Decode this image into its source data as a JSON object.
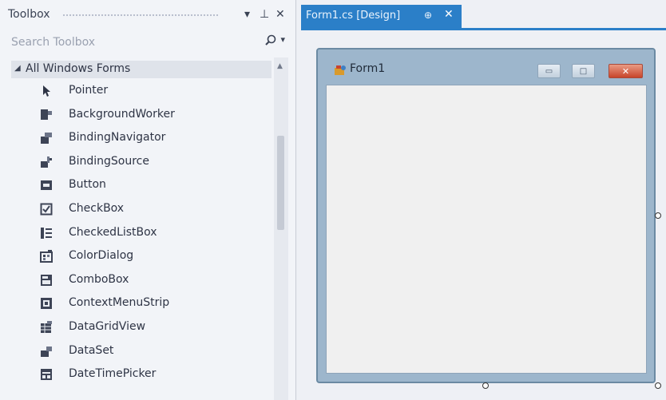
{
  "toolbox": {
    "title": "Toolbox",
    "dropdown_icon": "▾",
    "pin_icon": "⊥",
    "close_icon": "✕",
    "search_placeholder": "Search Toolbox",
    "search_icon": "⌕",
    "search_dropdown": "▾",
    "section": {
      "label": "All Windows Forms",
      "expanded_icon": "◢"
    },
    "items": [
      {
        "label": "Pointer",
        "icon": "pointer-icon"
      },
      {
        "label": "BackgroundWorker",
        "icon": "background-worker-icon"
      },
      {
        "label": "BindingNavigator",
        "icon": "binding-navigator-icon"
      },
      {
        "label": "BindingSource",
        "icon": "binding-source-icon"
      },
      {
        "label": "Button",
        "icon": "button-icon"
      },
      {
        "label": "CheckBox",
        "icon": "checkbox-icon"
      },
      {
        "label": "CheckedListBox",
        "icon": "checked-list-box-icon"
      },
      {
        "label": "ColorDialog",
        "icon": "color-dialog-icon"
      },
      {
        "label": "ComboBox",
        "icon": "combobox-icon"
      },
      {
        "label": "ContextMenuStrip",
        "icon": "context-menu-strip-icon"
      },
      {
        "label": "DataGridView",
        "icon": "data-grid-view-icon"
      },
      {
        "label": "DataSet",
        "icon": "dataset-icon"
      },
      {
        "label": "DateTimePicker",
        "icon": "date-time-picker-icon"
      }
    ]
  },
  "document_tab": {
    "label": "Form1.cs [Design]",
    "pin_icon": "⊕",
    "close_icon": "✕"
  },
  "form": {
    "title": "Form1",
    "minimize": "▭",
    "maximize": "□",
    "close": "✕"
  },
  "colors": {
    "accent": "#2b7fc8",
    "close_button": "#c8452b"
  }
}
